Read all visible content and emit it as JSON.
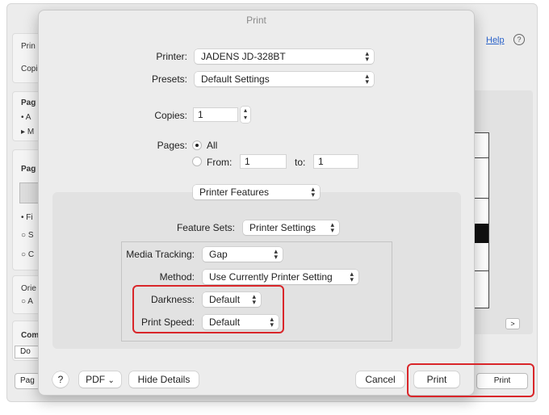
{
  "background": {
    "sidebar_labels": [
      "Prin",
      "Copi",
      "Pag",
      "A",
      "M",
      "Pag",
      "Fi",
      "S",
      "C",
      "Orie",
      "A",
      "Com",
      "Do",
      "Pag"
    ],
    "help_link": "Help",
    "help_icon": "?",
    "next_arrow": ">",
    "print_button": "Print"
  },
  "dialog": {
    "title": "Print",
    "printer": {
      "label": "Printer:",
      "value": "JADENS JD-328BT"
    },
    "presets": {
      "label": "Presets:",
      "value": "Default Settings"
    },
    "copies": {
      "label": "Copies:",
      "value": "1"
    },
    "pages": {
      "label": "Pages:",
      "all_label": "All",
      "from_label": "From:",
      "from_value": "1",
      "to_label": "to:",
      "to_value": "1",
      "selected": "All"
    },
    "section_select": "Printer Features",
    "feature_sets": {
      "label": "Feature Sets:",
      "value": "Printer Settings"
    },
    "media_tracking": {
      "label": "Media Tracking:",
      "value": "Gap"
    },
    "method": {
      "label": "Method:",
      "value": "Use Currently Printer Setting"
    },
    "darkness": {
      "label": "Darkness:",
      "value": "Default"
    },
    "print_speed": {
      "label": "Print Speed:",
      "value": "Default"
    },
    "footer": {
      "help": "?",
      "pdf": "PDF",
      "pdf_chevron": "⌄",
      "hide_details": "Hide Details",
      "cancel": "Cancel",
      "print": "Print"
    }
  },
  "colors": {
    "highlight": "#d9262a",
    "link": "#2a62c9"
  }
}
